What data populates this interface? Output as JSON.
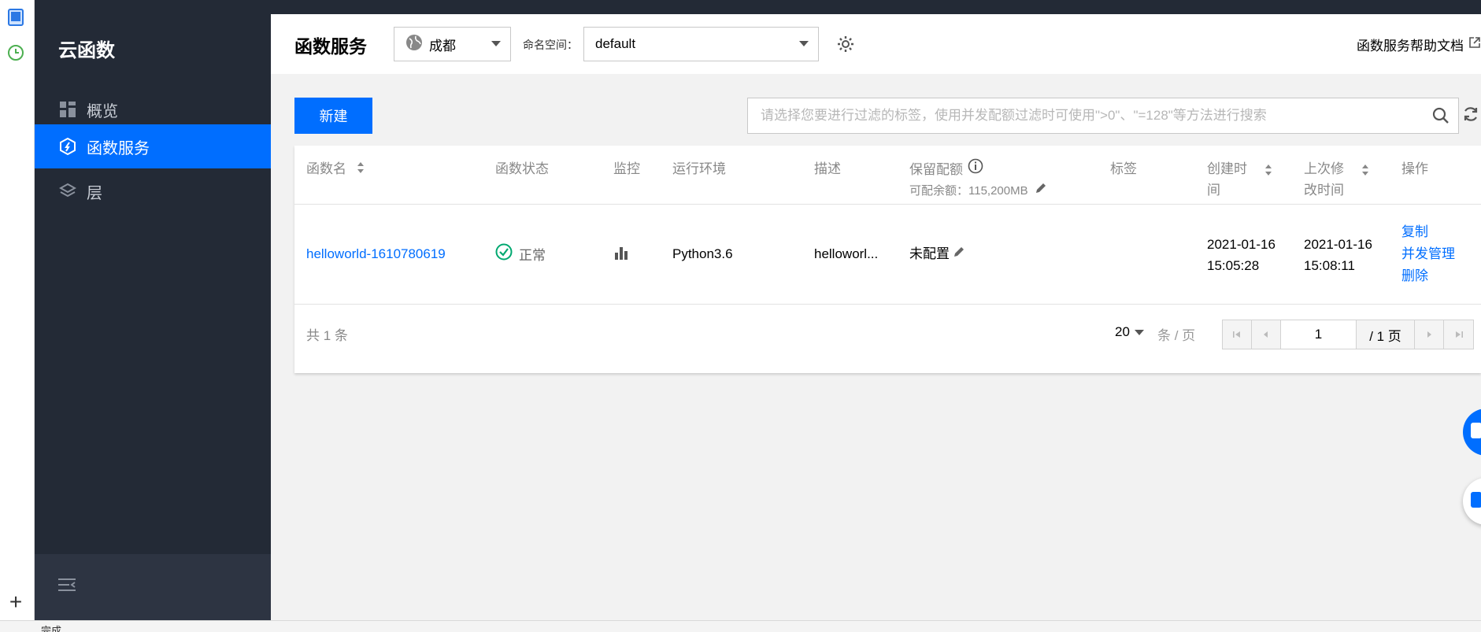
{
  "sidebar": {
    "title": "云函数",
    "items": [
      {
        "label": "概览",
        "icon": "dashboard-icon",
        "active": false
      },
      {
        "label": "函数服务",
        "icon": "function-icon",
        "active": true
      },
      {
        "label": "层",
        "icon": "layers-icon",
        "active": false
      }
    ]
  },
  "header": {
    "title": "函数服务",
    "region": "成都",
    "namespace_label": "命名空间：",
    "namespace": "default",
    "help_link": "函数服务帮助文档"
  },
  "toolbar": {
    "new_label": "新建",
    "search_placeholder": "请选择您要进行过滤的标签，使用并发配额过滤时可使用\">0\"、\"=128\"等方法进行搜索"
  },
  "table": {
    "columns": {
      "name": "函数名",
      "status": "函数状态",
      "monitor": "监控",
      "runtime": "运行环境",
      "desc": "描述",
      "reserved": "保留配额",
      "reserved_sub": "可配余额：115,200MB",
      "tags": "标签",
      "created_1": "创建时",
      "created_2": "间",
      "modified_1": "上次修",
      "modified_2": "改时间",
      "ops": "操作"
    },
    "rows": [
      {
        "name": "helloworld-1610780619",
        "status": "正常",
        "runtime": "Python3.6",
        "desc": "helloworl...",
        "reserved": "未配置",
        "tags": "",
        "created_date": "2021-01-16",
        "created_time": "15:05:28",
        "modified_date": "2021-01-16",
        "modified_time": "15:08:11",
        "op_copy": "复制",
        "op_concurrency": "并发管理",
        "op_delete": "删除"
      }
    ]
  },
  "footer": {
    "total_text": "共 1 条",
    "page_size": "20",
    "per_page_label": "条 / 页",
    "current_page": "1",
    "total_pages": "/ 1 页"
  },
  "statusbar": {
    "text": "完成"
  },
  "colors": {
    "accent": "#006eff",
    "sidebar_bg": "#232a36",
    "success": "#00a870"
  }
}
